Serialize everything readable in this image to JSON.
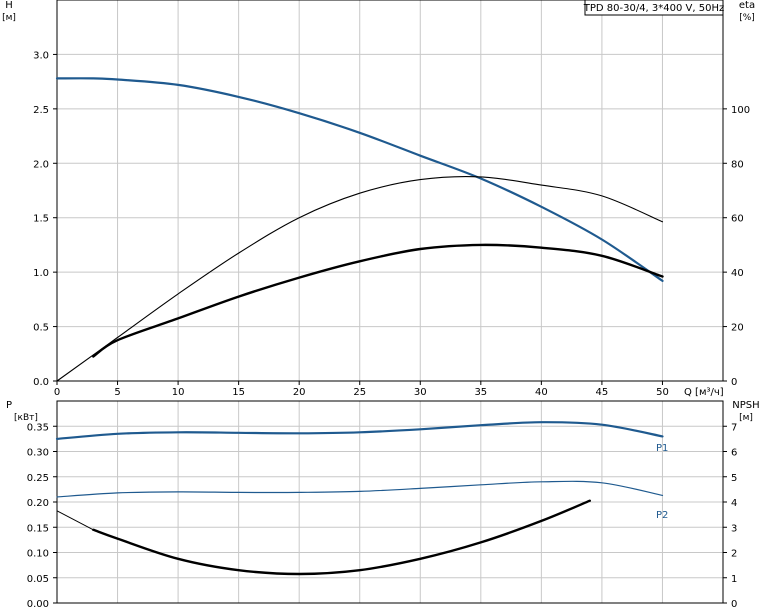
{
  "model_label": "TPD 80-30/4, 3*400 V, 50Hz",
  "chart_data": [
    {
      "type": "line",
      "panel": "head-efficiency",
      "x_axis": {
        "label": "Q [м³/ч]",
        "range": [
          0,
          55
        ],
        "ticks": [
          0,
          5,
          10,
          15,
          20,
          25,
          30,
          35,
          40,
          45,
          50
        ]
      },
      "y_left": {
        "label": "H",
        "unit": "[м]",
        "range": [
          0,
          3.5
        ],
        "ticks": [
          "0.0",
          "0.5",
          "1.0",
          "1.5",
          "2.0",
          "2.5",
          "3.0"
        ]
      },
      "y_right": {
        "label": "eta",
        "unit": "[%]",
        "range": [
          0,
          140
        ],
        "ticks": [
          0,
          20,
          40,
          60,
          80,
          100
        ]
      },
      "grid": true,
      "colors": {
        "head": "#1f5a8f",
        "efficiency": "#000000",
        "grid": "#c8c8c8"
      },
      "series": [
        {
          "key": "head",
          "axis": "left",
          "width": 2.2,
          "x": [
            0,
            3,
            5,
            10,
            15,
            20,
            25,
            30,
            35,
            40,
            45,
            50
          ],
          "y": [
            2.78,
            2.78,
            2.77,
            2.72,
            2.61,
            2.46,
            2.28,
            2.07,
            1.86,
            1.6,
            1.3,
            0.92
          ]
        },
        {
          "key": "efficiency-thin",
          "axis": "right",
          "width": 1.1,
          "x": [
            0,
            5,
            10,
            15,
            20,
            25,
            30,
            35,
            40,
            45,
            50
          ],
          "y": [
            0,
            16,
            32,
            47,
            60,
            69,
            74,
            75,
            72,
            68,
            58.5
          ]
        },
        {
          "key": "efficiency-thick",
          "axis": "right",
          "width": 2.4,
          "x": [
            3,
            5,
            10,
            15,
            20,
            25,
            30,
            35,
            40,
            45,
            50
          ],
          "y": [
            9,
            15,
            23,
            31,
            38,
            44,
            48.5,
            50,
            49,
            46,
            38.4
          ]
        }
      ]
    },
    {
      "type": "line",
      "panel": "power-npsh",
      "x_axis": {
        "range": [
          0,
          55
        ]
      },
      "y_left": {
        "label": "P",
        "unit": "[кВт]",
        "range": [
          0,
          0.4
        ],
        "ticks": [
          "0.00",
          "0.05",
          "0.10",
          "0.15",
          "0.20",
          "0.25",
          "0.30",
          "0.35"
        ]
      },
      "y_right": {
        "label": "NPSH",
        "unit": "[м]",
        "range": [
          0,
          8
        ],
        "ticks": [
          0,
          1,
          2,
          3,
          4,
          5,
          6,
          7
        ]
      },
      "grid": true,
      "colors": {
        "power": "#1f5a8f",
        "npsh": "#000000"
      },
      "series": [
        {
          "key": "P1",
          "name": "P1",
          "axis": "left",
          "width": 2.2,
          "x": [
            0,
            5,
            10,
            15,
            20,
            25,
            30,
            35,
            40,
            45,
            50
          ],
          "y": [
            0.325,
            0.335,
            0.338,
            0.337,
            0.336,
            0.338,
            0.344,
            0.352,
            0.358,
            0.353,
            0.33
          ]
        },
        {
          "key": "P2",
          "name": "P2",
          "axis": "left",
          "width": 1.2,
          "x": [
            0,
            5,
            10,
            15,
            20,
            25,
            30,
            35,
            40,
            45,
            50
          ],
          "y": [
            0.21,
            0.218,
            0.22,
            0.219,
            0.219,
            0.221,
            0.227,
            0.234,
            0.24,
            0.238,
            0.213
          ]
        },
        {
          "key": "npsh-thin",
          "axis": "right",
          "width": 0.9,
          "x": [
            0,
            3
          ],
          "y": [
            3.65,
            2.9
          ]
        },
        {
          "key": "npsh-thick",
          "axis": "right",
          "width": 2.4,
          "x": [
            3,
            5,
            10,
            15,
            20,
            25,
            30,
            35,
            40,
            44
          ],
          "y": [
            2.9,
            2.55,
            1.75,
            1.3,
            1.15,
            1.3,
            1.75,
            2.4,
            3.25,
            4.05
          ]
        }
      ]
    }
  ]
}
